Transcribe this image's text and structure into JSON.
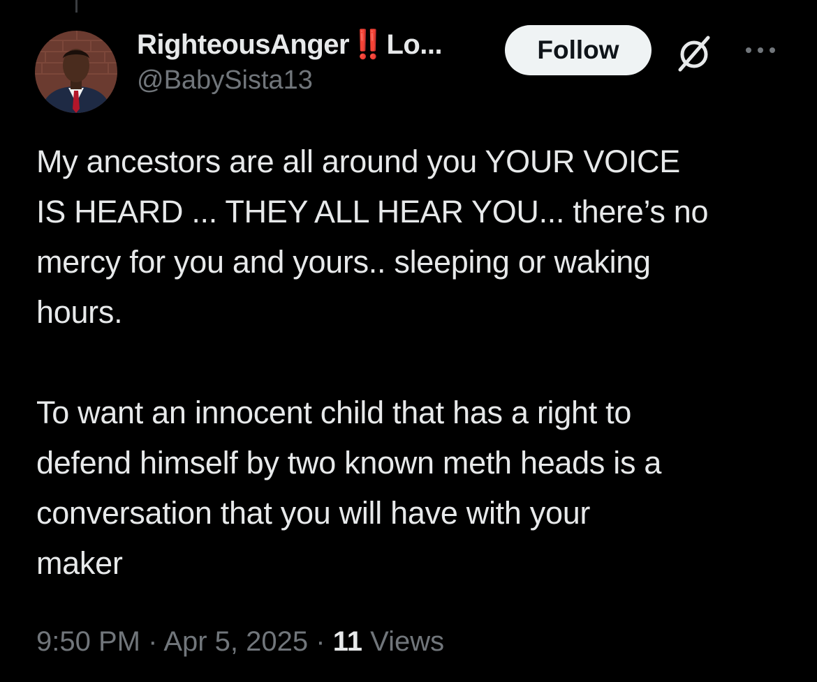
{
  "author": {
    "display_name": "RighteousAnger",
    "name_emoji": "‼️",
    "name_suffix": "Lo...",
    "handle": "@BabySista13",
    "avatar_icon": "profile-photo"
  },
  "actions": {
    "follow_label": "Follow",
    "grok_icon": "grok-icon",
    "more_icon": "more-options-icon"
  },
  "tweet": {
    "paragraph_1": "My ancestors are all around you YOUR VOICE\nIS HEARD ... THEY ALL HEAR YOU... there’s no\nmercy for you and yours.. sleeping or waking\nhours.",
    "paragraph_2": "To want an innocent child that has a right to\ndefend himself by two known meth heads is a\nconversation that you will have with your\nmaker"
  },
  "meta": {
    "time": "9:50 PM",
    "separator": " · ",
    "date": "Apr 5, 2025",
    "views_count": "11",
    "views_label": "Views"
  },
  "colors": {
    "background": "#000000",
    "text_primary": "#e7e9ea",
    "text_secondary": "#71767b",
    "follow_button_bg": "#eff3f4",
    "emoji_red": "#e0243a"
  }
}
